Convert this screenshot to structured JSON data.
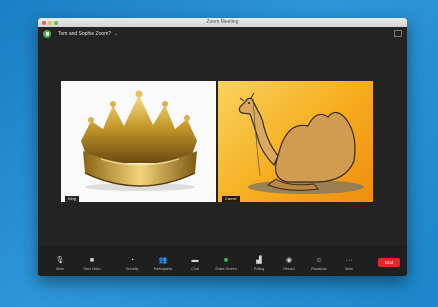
{
  "window": {
    "title": "Zoom Meeting",
    "meeting_name": "Tom and Sophie Zoom?",
    "chevron": "⌄",
    "view_icon": "grid-view-icon"
  },
  "participants": [
    {
      "name": "King"
    },
    {
      "name": "Camel"
    }
  ],
  "toolbar": {
    "mute": {
      "icon": "microphone-icon",
      "glyph": "🎙",
      "label": "Mute"
    },
    "video": {
      "icon": "video-camera-icon",
      "glyph": "■",
      "label": "Start Video"
    },
    "security": {
      "icon": "shield-icon",
      "glyph": "◔",
      "label": "Security"
    },
    "participants": {
      "icon": "people-icon",
      "glyph": "👥",
      "label": "Participants"
    },
    "chat": {
      "icon": "chat-bubble-icon",
      "glyph": "▬",
      "label": "Chat"
    },
    "share": {
      "icon": "share-screen-icon",
      "glyph": "■",
      "label": "Share Screen"
    },
    "polling": {
      "icon": "bar-chart-icon",
      "glyph": "▟",
      "label": "Polling"
    },
    "record": {
      "icon": "record-icon",
      "glyph": "◉",
      "label": "Record"
    },
    "reactions": {
      "icon": "smiley-icon",
      "glyph": "☺",
      "label": "Reactions"
    },
    "more": {
      "icon": "ellipsis-icon",
      "glyph": "···",
      "label": "More"
    },
    "end": {
      "label": "End"
    }
  },
  "colors": {
    "accent_green": "#3bc24a",
    "end_red": "#e02828",
    "background_blue": "#2d96d8"
  }
}
